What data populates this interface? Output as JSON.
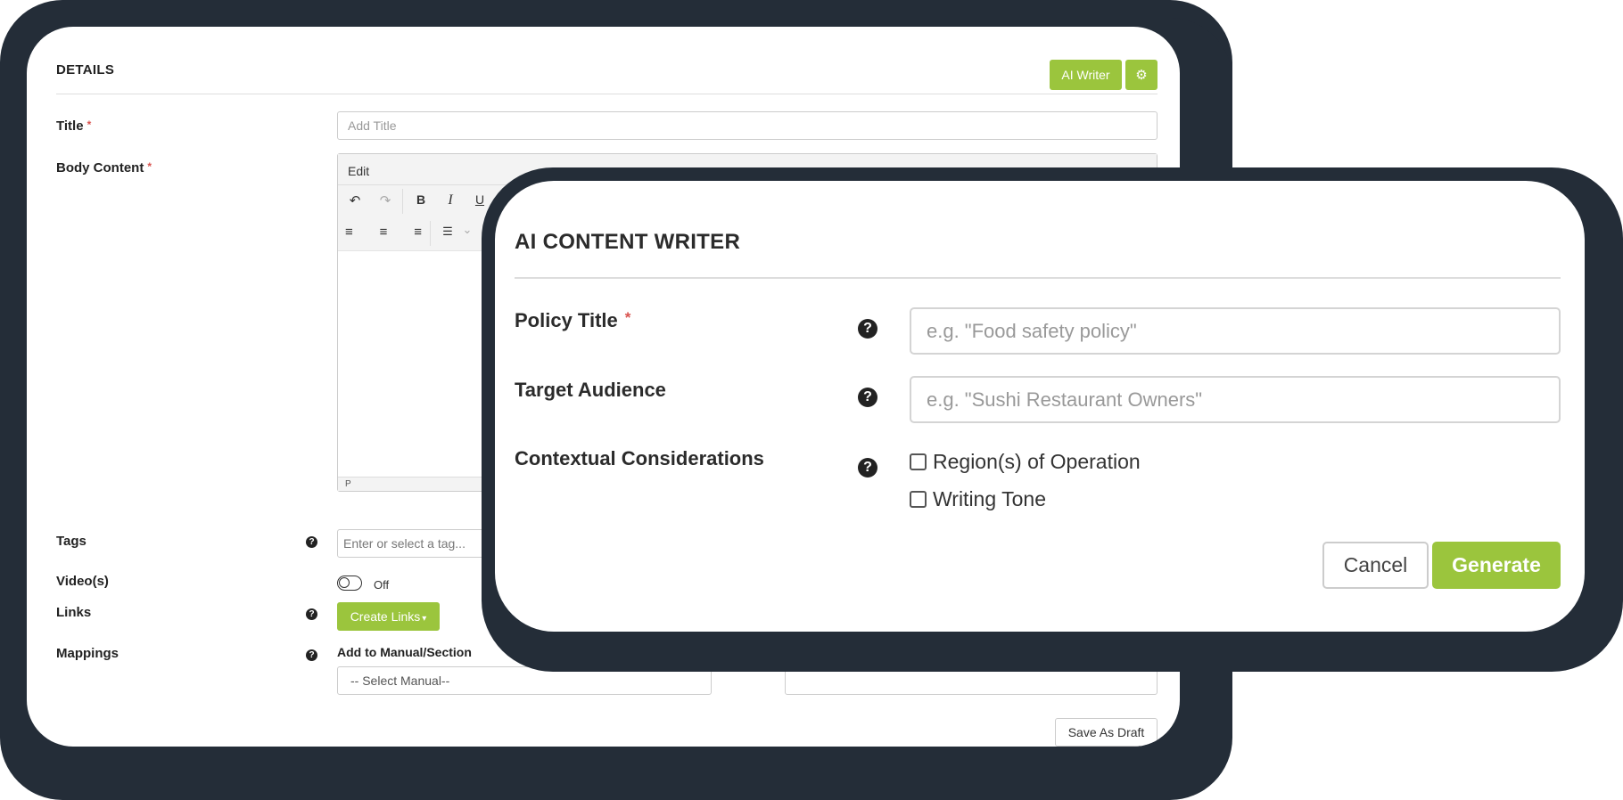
{
  "details": {
    "section_title": "DETAILS",
    "ai_writer_label": "AI Writer",
    "gear_icon": "⚙",
    "fields": {
      "title_label": "Title",
      "title_placeholder": "Add Title",
      "body_label": "Body Content",
      "tags_label": "Tags",
      "tags_placeholder": "Enter or select a tag...",
      "videos_label": "Video(s)",
      "videos_toggle_state": "Off",
      "links_label": "Links",
      "create_links_label": "Create Links",
      "mappings_label": "Mappings",
      "add_to_manual_label": "Add to Manual/Section",
      "select_manual_value": "-- Select Manual--"
    },
    "required_marker": "*",
    "help_icon": "?",
    "editor": {
      "menu_label": "Edit",
      "status_path": "P",
      "toolbar_icons": {
        "undo": "↶",
        "redo": "↷",
        "bold": "B",
        "italic": "I",
        "underline": "U",
        "align_left": "≡",
        "align_center": "≡",
        "align_right": "≡",
        "bullet_list": "☰",
        "dropdown": "⌄"
      }
    },
    "save_draft_label": "Save As Draft",
    "caret": "▾"
  },
  "modal": {
    "title": "AI CONTENT WRITER",
    "policy_title_label": "Policy Title",
    "policy_title_placeholder": "e.g. \"Food safety policy\"",
    "target_audience_label": "Target Audience",
    "target_audience_placeholder": "e.g. \"Sushi Restaurant Owners\"",
    "contextual_label": "Contextual Considerations",
    "checkbox_region": "Region(s) of Operation",
    "checkbox_tone": "Writing Tone",
    "cancel_label": "Cancel",
    "generate_label": "Generate"
  },
  "colors": {
    "accent_green": "#9bc53d",
    "frame_dark": "#242d38",
    "required_red": "#d9534f"
  }
}
